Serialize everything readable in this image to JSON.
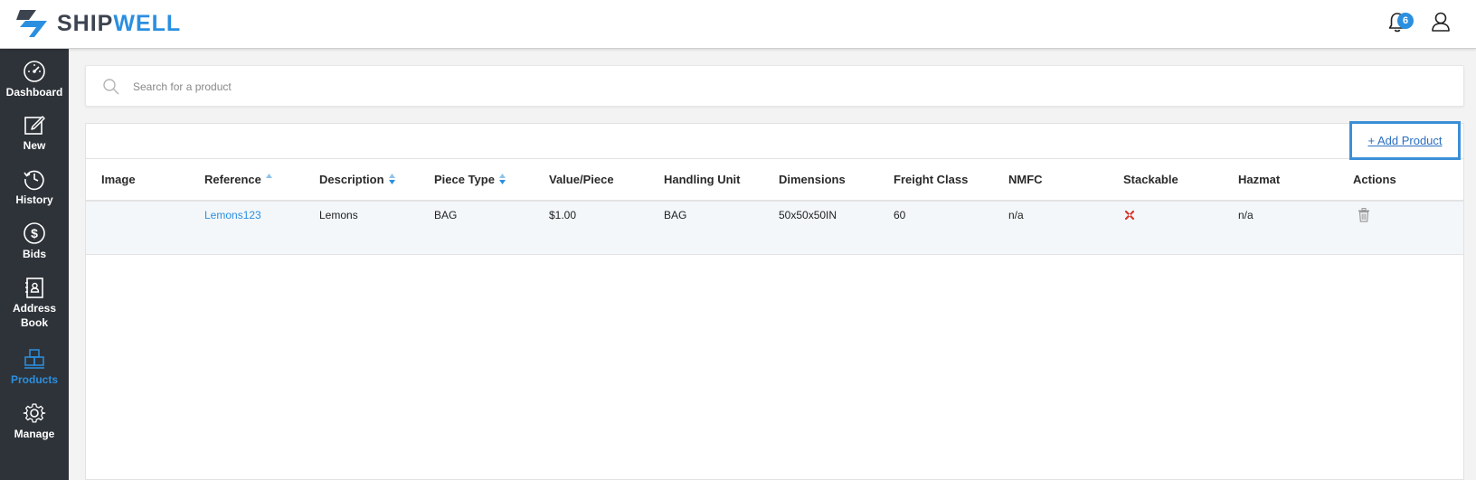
{
  "app": {
    "brand_part1": "SHIP",
    "brand_part2": "WELL",
    "notification_count": "6",
    "brand_color": "#2b8fe0",
    "sidebar_color": "#2e3339"
  },
  "sidebar": {
    "items": [
      {
        "label": "Dashboard",
        "icon": "speedometer-icon"
      },
      {
        "label": "New",
        "icon": "edit-icon"
      },
      {
        "label": "History",
        "icon": "history-clock-icon"
      },
      {
        "label": "Bids",
        "icon": "dollar-icon"
      },
      {
        "label": "Address Book",
        "icon": "contact-book-icon"
      },
      {
        "label": "Products",
        "icon": "boxes-icon",
        "active": true
      },
      {
        "label": "Manage",
        "icon": "gear-icon"
      }
    ]
  },
  "search": {
    "placeholder": "Search for a product",
    "value": ""
  },
  "toolbar": {
    "add_product_label": "+ Add Product"
  },
  "table": {
    "columns": [
      {
        "label": "Image",
        "sortable": false
      },
      {
        "label": "Reference",
        "sortable": true
      },
      {
        "label": "Description",
        "sortable": true
      },
      {
        "label": "Piece Type",
        "sortable": true
      },
      {
        "label": "Value/Piece",
        "sortable": false
      },
      {
        "label": "Handling Unit",
        "sortable": false
      },
      {
        "label": "Dimensions",
        "sortable": false
      },
      {
        "label": "Freight Class",
        "sortable": false
      },
      {
        "label": "NMFC",
        "sortable": false
      },
      {
        "label": "Stackable",
        "sortable": false
      },
      {
        "label": "Hazmat",
        "sortable": false
      },
      {
        "label": "Actions",
        "sortable": false
      }
    ],
    "rows": [
      {
        "image": "",
        "reference": "Lemons123",
        "description": "Lemons",
        "piece_type": "BAG",
        "value_per_piece": "$1.00",
        "handling_unit": "BAG",
        "dimensions": "50x50x50IN",
        "freight_class": "60",
        "nmfc": "n/a",
        "stackable": false,
        "hazmat": "n/a",
        "actions": [
          "trash-icon"
        ]
      }
    ]
  }
}
